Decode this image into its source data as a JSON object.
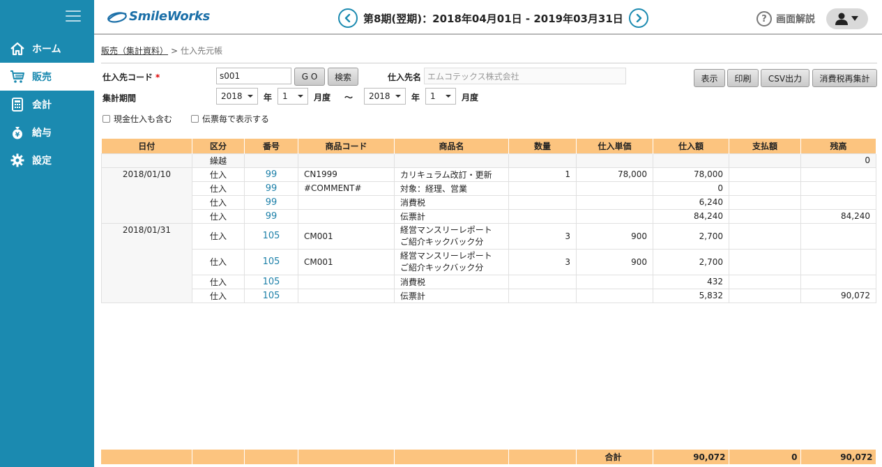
{
  "sidebar": {
    "items": [
      {
        "label": "ホーム",
        "icon": "home-icon"
      },
      {
        "label": "販売",
        "icon": "cart-icon"
      },
      {
        "label": "会計",
        "icon": "calculator-icon"
      },
      {
        "label": "給与",
        "icon": "money-bag-icon"
      },
      {
        "label": "設定",
        "icon": "gear-icon"
      }
    ],
    "active": "販売"
  },
  "header": {
    "logo": "SmileWorks",
    "period": "第8期(翌期)：2018年04月01日 - 2019年03月31日",
    "help_label": "画面解説"
  },
  "breadcrumb": {
    "parent": "販売（集計資料）",
    "separator": ">",
    "current": "仕入先元帳"
  },
  "form": {
    "supplier_code_label": "仕入先コード",
    "required_mark": "*",
    "supplier_code_value": "s001",
    "go_label": "G O",
    "search_label": "検索",
    "supplier_name_label": "仕入先名",
    "supplier_name_value": "エムコテックス株式会社",
    "period_label": "集計期間",
    "from_year": "2018",
    "from_month": "1",
    "to_year": "2018",
    "to_month": "1",
    "year_unit": "年",
    "month_unit": "月度",
    "tilde": "〜",
    "include_cash_label": "現金仕入も含む",
    "per_slip_label": "伝票毎で表示する"
  },
  "actions": {
    "display": "表示",
    "print": "印刷",
    "csv": "CSV出力",
    "recalc_tax": "消費税再集計"
  },
  "table": {
    "headers": [
      "日付",
      "区分",
      "番号",
      "商品コード",
      "商品名",
      "数量",
      "仕入単価",
      "仕入額",
      "支払額",
      "残高"
    ],
    "carry": {
      "kubun": "繰越",
      "balance": "0"
    },
    "groups": [
      {
        "date": "2018/01/10",
        "rows": [
          {
            "kubun": "仕入",
            "no": "99",
            "code": "CN1999",
            "name": "カリキュラム改訂・更新",
            "name2": "",
            "qty": "1",
            "unit": "78,000",
            "amount": "78,000",
            "paid": "",
            "balance": ""
          },
          {
            "kubun": "仕入",
            "no": "99",
            "code": "#COMMENT#",
            "name": "対象：経理、営業",
            "name2": "",
            "qty": "",
            "unit": "",
            "amount": "0",
            "paid": "",
            "balance": ""
          },
          {
            "kubun": "仕入",
            "no": "99",
            "code": "",
            "name": "消費税",
            "name2": "",
            "qty": "",
            "unit": "",
            "amount": "6,240",
            "paid": "",
            "balance": ""
          },
          {
            "kubun": "仕入",
            "no": "99",
            "code": "",
            "name": "伝票計",
            "name2": "",
            "qty": "",
            "unit": "",
            "amount": "84,240",
            "paid": "",
            "balance": "84,240"
          }
        ]
      },
      {
        "date": "2018/01/31",
        "rows": [
          {
            "kubun": "仕入",
            "no": "105",
            "code": "CM001",
            "name": "経営マンスリーレポート",
            "name2": "ご紹介キックバック分",
            "qty": "3",
            "unit": "900",
            "amount": "2,700",
            "paid": "",
            "balance": ""
          },
          {
            "kubun": "仕入",
            "no": "105",
            "code": "CM001",
            "name": "経営マンスリーレポート",
            "name2": "ご紹介キックバック分",
            "qty": "3",
            "unit": "900",
            "amount": "2,700",
            "paid": "",
            "balance": ""
          },
          {
            "kubun": "仕入",
            "no": "105",
            "code": "",
            "name": "消費税",
            "name2": "",
            "qty": "",
            "unit": "",
            "amount": "432",
            "paid": "",
            "balance": ""
          },
          {
            "kubun": "仕入",
            "no": "105",
            "code": "",
            "name": "伝票計",
            "name2": "",
            "qty": "",
            "unit": "",
            "amount": "5,832",
            "paid": "",
            "balance": "90,072"
          }
        ]
      }
    ]
  },
  "totals": {
    "label": "合計",
    "amount": "90,072",
    "paid": "0",
    "balance": "90,072"
  },
  "colors": {
    "sidebar": "#1b8ab0",
    "table_header": "#fcc47f",
    "link": "#1b7fa8"
  }
}
